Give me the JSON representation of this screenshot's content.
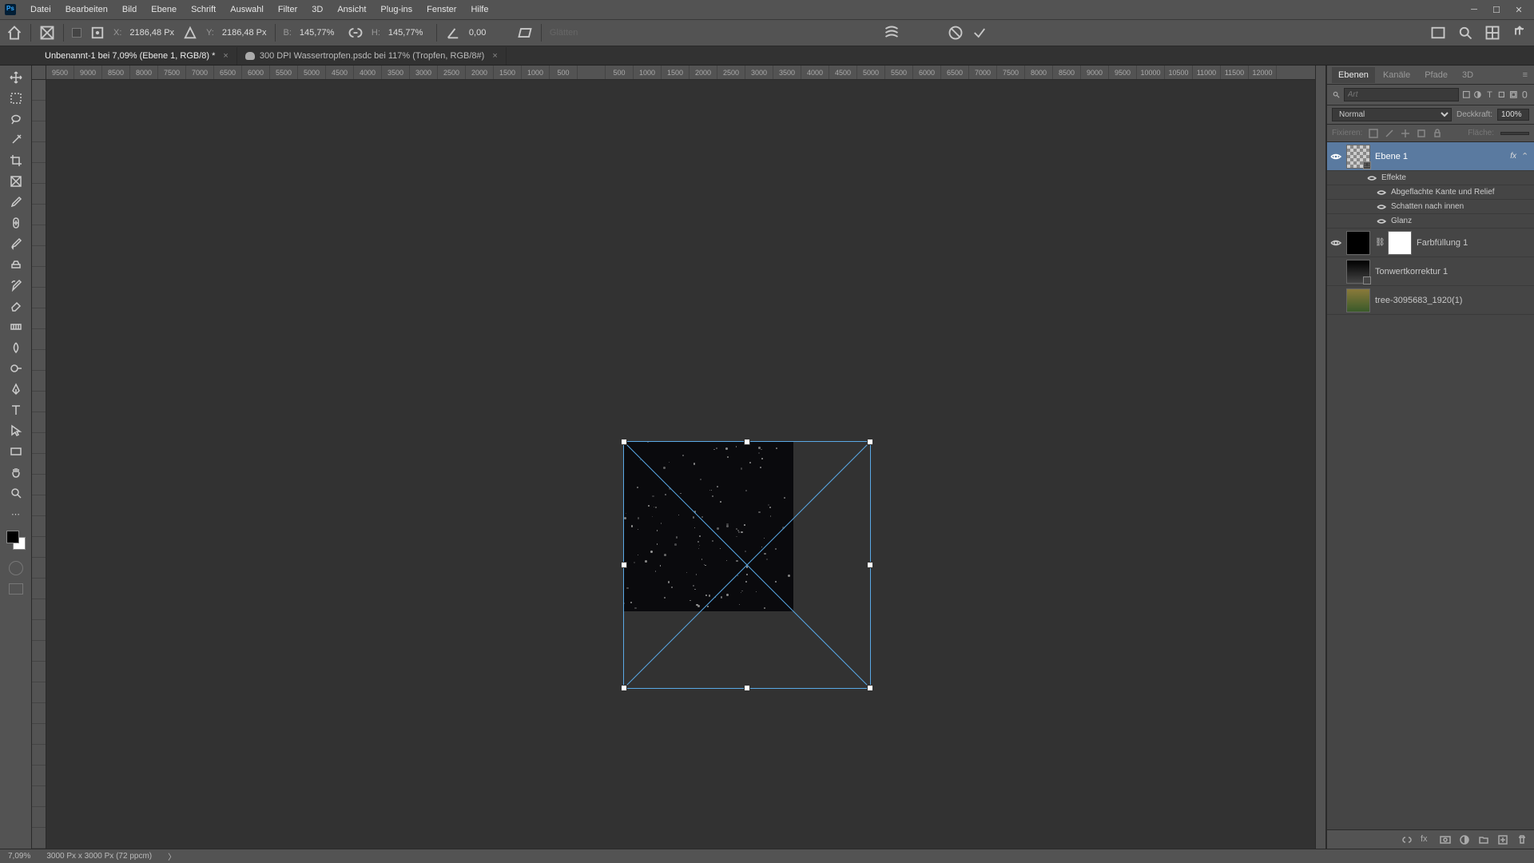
{
  "menu": [
    "Datei",
    "Bearbeiten",
    "Bild",
    "Ebene",
    "Schrift",
    "Auswahl",
    "Filter",
    "3D",
    "Ansicht",
    "Plug-ins",
    "Fenster",
    "Hilfe"
  ],
  "optbar": {
    "x_label": "X:",
    "x_value": "2186,48 Px",
    "y_label": "Y:",
    "y_value": "2186,48 Px",
    "w_label": "B:",
    "w_value": "145,77%",
    "h_label": "H:",
    "h_value": "145,77%",
    "rot_value": "0,00",
    "glatten": "Glätten"
  },
  "tabs": {
    "tab1": "Unbenannt-1 bei 7,09% (Ebene 1, RGB/8) *",
    "tab2": "300 DPI Wassertropfen.psdc bei 117% (Tropfen, RGB/8#)"
  },
  "ruler_h": [
    "9500",
    "9000",
    "8500",
    "8000",
    "7500",
    "7000",
    "6500",
    "6000",
    "5500",
    "5000",
    "4500",
    "4000",
    "3500",
    "3000",
    "2500",
    "2000",
    "1500",
    "1000",
    "500",
    "",
    "500",
    "1000",
    "1500",
    "2000",
    "2500",
    "3000",
    "3500",
    "4000",
    "4500",
    "5000",
    "5500",
    "6000",
    "6500",
    "7000",
    "7500",
    "8000",
    "8500",
    "9000",
    "9500",
    "10000",
    "10500",
    "11000",
    "11500",
    "12000"
  ],
  "panels": {
    "tabs": [
      "Ebenen",
      "Kanäle",
      "Pfade",
      "3D"
    ],
    "search_ph": "Art",
    "blend_mode": "Normal",
    "opacity_label": "Deckkraft:",
    "opacity_value": "100%",
    "lock_label": "Fixieren:",
    "fill_label": "Fläche:",
    "layer1": "Ebene 1",
    "fx": "fx",
    "effects": "Effekte",
    "bevel": "Abgeflachte Kante und Relief",
    "inner_shadow": "Schatten nach innen",
    "satin": "Glanz",
    "fill1": "Farbfüllung 1",
    "curves": "Tonwertkorrektur 1",
    "tree": "tree-3095683_1920(1)"
  },
  "status": {
    "zoom": "7,09%",
    "docinfo": "3000 Px x 3000 Px (72 ppcm)"
  }
}
